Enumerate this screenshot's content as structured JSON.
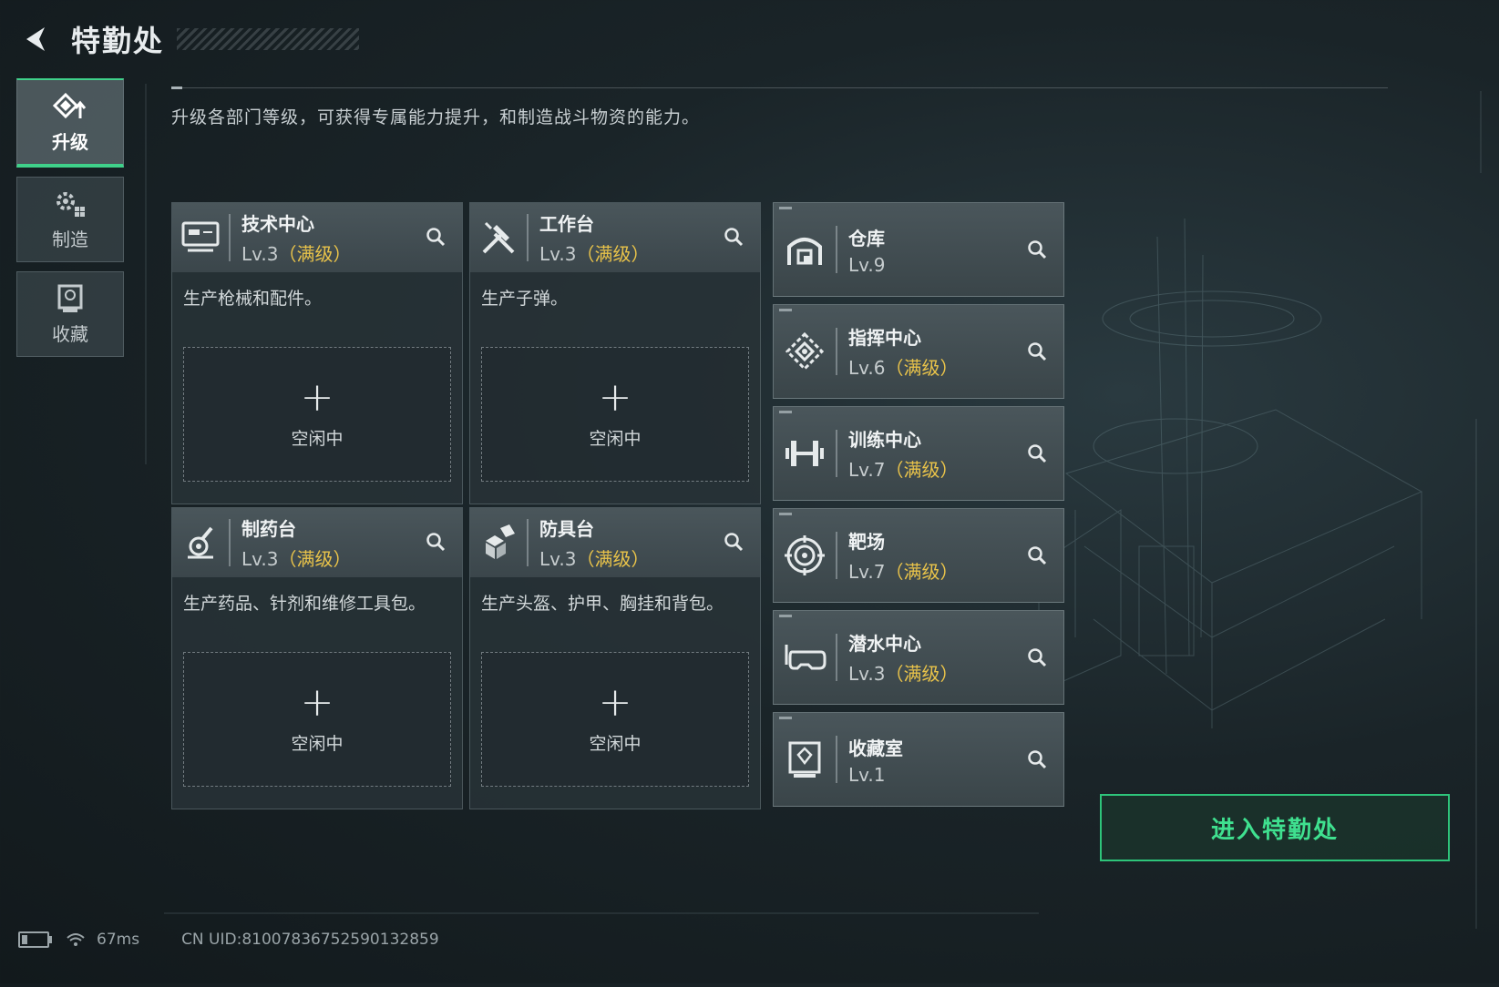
{
  "header": {
    "title": "特勤处"
  },
  "nav": [
    {
      "label": "升级",
      "icon": "upgrade-icon",
      "active": true
    },
    {
      "label": "制造",
      "icon": "gears-icon",
      "active": false
    },
    {
      "label": "收藏",
      "icon": "collection-icon",
      "active": false
    }
  ],
  "description": "升级各部门等级，可获得专属能力提升，和制造战斗物资的能力。",
  "production": [
    {
      "name": "技术中心",
      "level": "Lv.3",
      "max": "（满级）",
      "text": "生产枪械和配件。",
      "slot_plus": "+",
      "slot_status": "空闲中",
      "icon": "tech-center-icon"
    },
    {
      "name": "工作台",
      "level": "Lv.3",
      "max": "（满级）",
      "text": "生产子弹。",
      "slot_plus": "+",
      "slot_status": "空闲中",
      "icon": "workbench-icon"
    },
    {
      "name": "制药台",
      "level": "Lv.3",
      "max": "（满级）",
      "text": "生产药品、针剂和维修工具包。",
      "slot_plus": "+",
      "slot_status": "空闲中",
      "icon": "pharmacy-icon"
    },
    {
      "name": "防具台",
      "level": "Lv.3",
      "max": "（满级）",
      "text": "生产头盔、护甲、胸挂和背包。",
      "slot_plus": "+",
      "slot_status": "空闲中",
      "icon": "armor-bench-icon"
    }
  ],
  "facilities": [
    {
      "name": "仓库",
      "level": "Lv.9",
      "max": "",
      "icon": "warehouse-icon"
    },
    {
      "name": "指挥中心",
      "level": "Lv.6",
      "max": "（满级）",
      "icon": "command-center-icon"
    },
    {
      "name": "训练中心",
      "level": "Lv.7",
      "max": "（满级）",
      "icon": "training-center-icon"
    },
    {
      "name": "靶场",
      "level": "Lv.7",
      "max": "（满级）",
      "icon": "shooting-range-icon"
    },
    {
      "name": "潜水中心",
      "level": "Lv.3",
      "max": "（满级）",
      "icon": "diving-center-icon"
    },
    {
      "name": "收藏室",
      "level": "Lv.1",
      "max": "",
      "icon": "collection-room-icon"
    }
  ],
  "enter_button": "进入特勤处",
  "status": {
    "ping": "67ms",
    "uid": "CN UID:810078367525901328​59"
  },
  "colors": {
    "accent": "#3fd18a",
    "max_level": "#e9c34a"
  }
}
